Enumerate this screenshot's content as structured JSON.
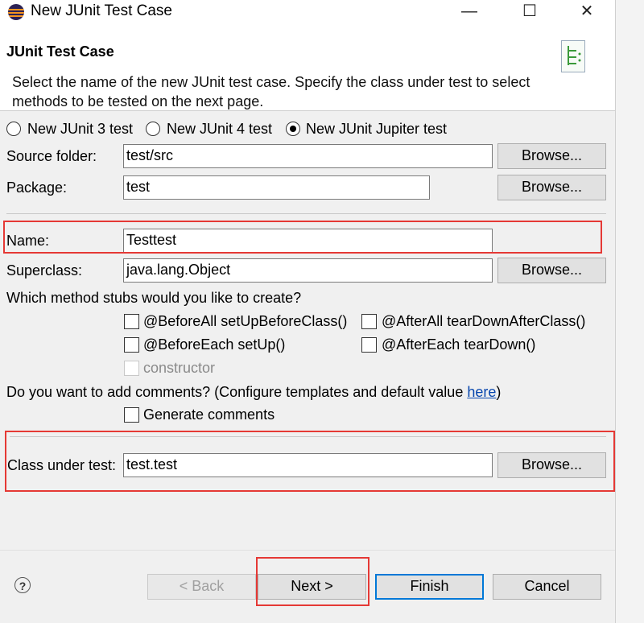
{
  "window": {
    "title": "New JUnit Test Case",
    "minimize_icon": "minimize-icon",
    "maximize_icon": "maximize-icon",
    "close_icon": "close-icon"
  },
  "banner": {
    "title": "JUnit Test Case",
    "description": "Select the name of the new JUnit test case. Specify the class under test to select methods to be tested on the next page."
  },
  "junit_version": {
    "options": [
      "New JUnit 3 test",
      "New JUnit 4 test",
      "New JUnit Jupiter test"
    ],
    "selected": "New JUnit Jupiter test"
  },
  "source_folder": {
    "label": "Source folder:",
    "value": "test/src",
    "browse": "Browse..."
  },
  "package": {
    "label": "Package:",
    "value": "test",
    "browse": "Browse..."
  },
  "name": {
    "label": "Name:",
    "value": "Testtest"
  },
  "superclass": {
    "label": "Superclass:",
    "value": "java.lang.Object",
    "browse": "Browse..."
  },
  "stubs": {
    "question": "Which method stubs would you like to create?",
    "before_all": "@BeforeAll setUpBeforeClass()",
    "after_all": "@AfterAll tearDownAfterClass()",
    "before_each": "@BeforeEach setUp()",
    "after_each": "@AfterEach tearDown()",
    "constructor": "constructor"
  },
  "comments": {
    "question_prefix": "Do you want to add comments? (Configure templates and default value ",
    "link": "here",
    "question_suffix": ")",
    "generate": "Generate comments"
  },
  "class_under_test": {
    "label": "Class under test:",
    "value": "test.test",
    "browse": "Browse..."
  },
  "footer": {
    "back": "< Back",
    "next": "Next >",
    "finish": "Finish",
    "cancel": "Cancel",
    "help": "?"
  }
}
